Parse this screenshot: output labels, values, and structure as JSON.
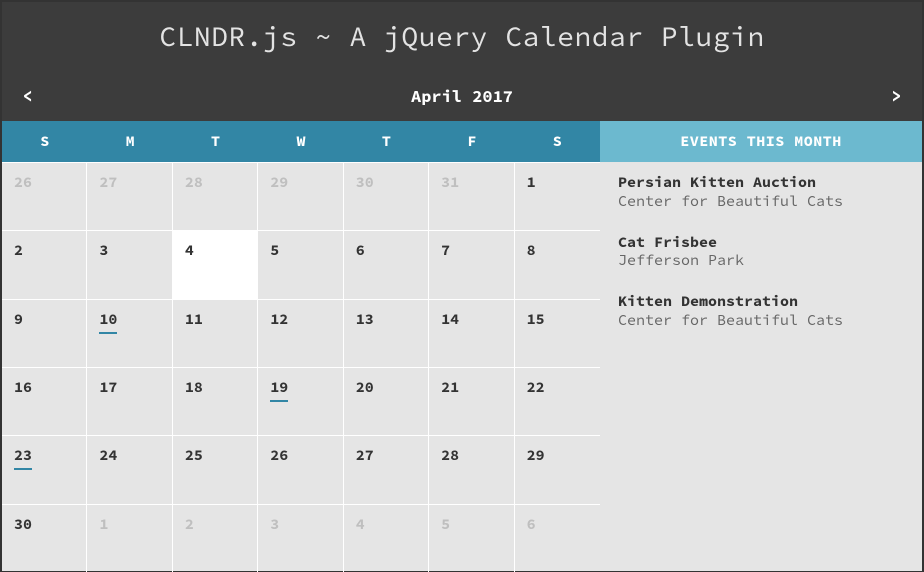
{
  "page": {
    "title": "CLNDR.js ~ A jQuery Calendar Plugin"
  },
  "nav": {
    "prev": "<",
    "next": ">",
    "month": "April 2017"
  },
  "dayHeaders": [
    "S",
    "M",
    "T",
    "W",
    "T",
    "F",
    "S"
  ],
  "days": [
    {
      "n": "26",
      "adjacent": true
    },
    {
      "n": "27",
      "adjacent": true
    },
    {
      "n": "28",
      "adjacent": true
    },
    {
      "n": "29",
      "adjacent": true
    },
    {
      "n": "30",
      "adjacent": true
    },
    {
      "n": "31",
      "adjacent": true
    },
    {
      "n": "1"
    },
    {
      "n": "2"
    },
    {
      "n": "3"
    },
    {
      "n": "4",
      "today": true
    },
    {
      "n": "5"
    },
    {
      "n": "6"
    },
    {
      "n": "7"
    },
    {
      "n": "8"
    },
    {
      "n": "9"
    },
    {
      "n": "10",
      "event": true
    },
    {
      "n": "11"
    },
    {
      "n": "12"
    },
    {
      "n": "13"
    },
    {
      "n": "14"
    },
    {
      "n": "15"
    },
    {
      "n": "16"
    },
    {
      "n": "17"
    },
    {
      "n": "18"
    },
    {
      "n": "19",
      "event": true
    },
    {
      "n": "20"
    },
    {
      "n": "21"
    },
    {
      "n": "22"
    },
    {
      "n": "23",
      "event": true
    },
    {
      "n": "24"
    },
    {
      "n": "25"
    },
    {
      "n": "26"
    },
    {
      "n": "27"
    },
    {
      "n": "28"
    },
    {
      "n": "29"
    },
    {
      "n": "30"
    },
    {
      "n": "1",
      "adjacent": true
    },
    {
      "n": "2",
      "adjacent": true
    },
    {
      "n": "3",
      "adjacent": true
    },
    {
      "n": "4",
      "adjacent": true
    },
    {
      "n": "5",
      "adjacent": true
    },
    {
      "n": "6",
      "adjacent": true
    }
  ],
  "sidebar": {
    "header": "EVENTS THIS MONTH",
    "events": [
      {
        "title": "Persian Kitten Auction",
        "location": "Center for Beautiful Cats"
      },
      {
        "title": "Cat Frisbee",
        "location": "Jefferson Park"
      },
      {
        "title": "Kitten Demonstration",
        "location": "Center for Beautiful Cats"
      }
    ]
  }
}
